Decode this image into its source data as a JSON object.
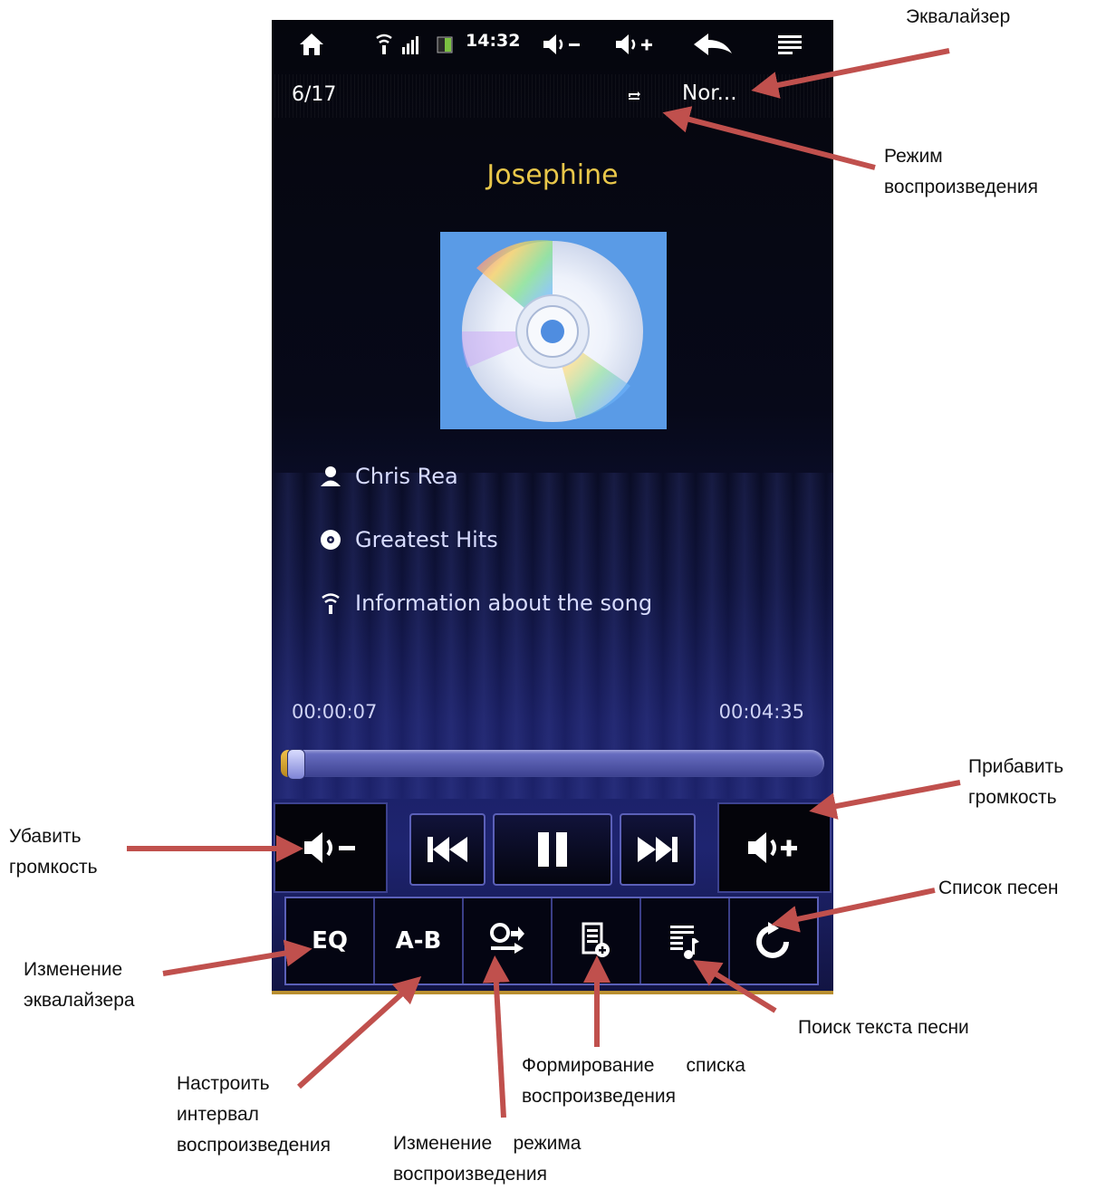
{
  "status_bar": {
    "time": "14:32",
    "icons": [
      "home-icon",
      "wifi-icon",
      "signal-icon",
      "battery-icon",
      "volume-down-icon",
      "volume-up-icon",
      "back-icon",
      "menu-icon"
    ]
  },
  "player": {
    "track_counter": "6/17",
    "equalizer_label": "Nor...",
    "play_mode_icon": "repeat-icon",
    "song_title": "Josephine",
    "artist": "Chris Rea",
    "album": "Greatest Hits",
    "info": "Information about the song",
    "elapsed": "00:00:07",
    "duration": "00:04:35",
    "progress": 0.027
  },
  "bottom_buttons": {
    "eq": "EQ",
    "ab": "A-B"
  },
  "annotations": {
    "equalizer": "Эквалайзер",
    "play_mode_1": "Режим",
    "play_mode_2": "воспроизведения",
    "vol_up_1": "Прибавить",
    "vol_up_2": "громкость",
    "vol_down_1": "Убавить",
    "vol_down_2": "громкость",
    "song_list": "Список песен",
    "eq_change_1": "Изменение",
    "eq_change_2": "эквалайзера",
    "lyrics_search": "Поиск текста песни",
    "playlist_1": "Формирование      списка",
    "playlist_2": "воспроизведения",
    "ab_1": "Настроить",
    "ab_2": "интервал",
    "ab_3": "воспроизведения",
    "mode_change_1": "Изменение    режима",
    "mode_change_2": "воспроизведения"
  },
  "colors": {
    "title": "#e9c74a",
    "arrow": "#c0504d",
    "accent": "#5b60b8"
  }
}
